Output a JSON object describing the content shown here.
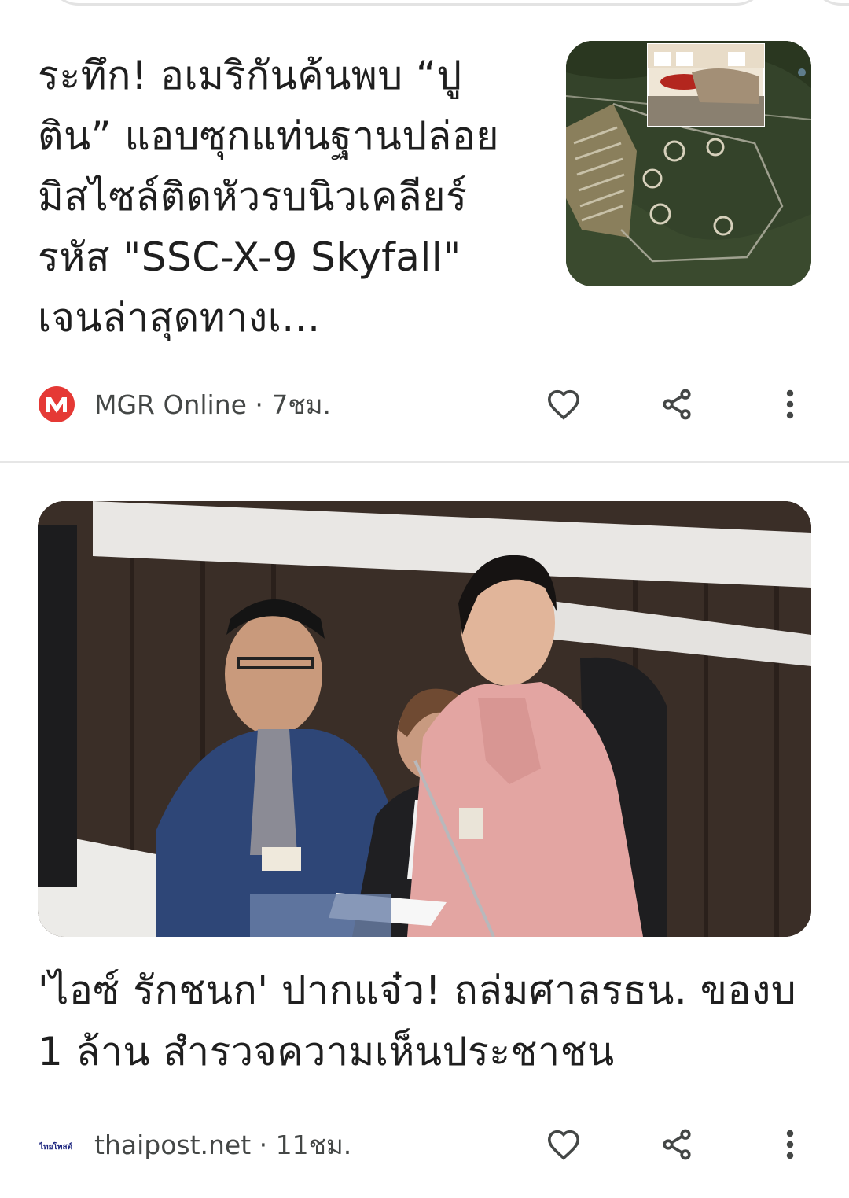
{
  "articles": [
    {
      "headline": "ระทึก! อเมริกันค้นพบ “ปูติน” แอบซุกแท่นฐานปล่อยมิสไซล์ติดหัวรบนิวเคลียร์รหัส \"SSC-X-9 Skyfall\" เจนล่าสุดทางเ...",
      "source": "MGR Online",
      "time": "7ชม.",
      "separator": " · ",
      "logo_letter": "M",
      "logo_color": "#e53935",
      "thumbnail": "satellite-map-image"
    },
    {
      "headline": "'ไอซ์ รักชนก' ปากแจ๋ว! ถล่มศาลรธน. ของบ 1 ล้าน สำรวจความเห็นประชาชน",
      "source": "thaipost.net",
      "time": "11ชม.",
      "separator": " · ",
      "logo_text": "ไทยโพสต์",
      "logo_color": "#1a237e",
      "hero_image": "parliament-photo"
    }
  ],
  "icons": {
    "like": "heart-outline-icon",
    "share": "share-icon",
    "more": "more-vert-icon"
  },
  "colors": {
    "icon": "#444746",
    "text": "#1f1f1f",
    "meta": "#444746",
    "divider": "#e6e6e6"
  }
}
